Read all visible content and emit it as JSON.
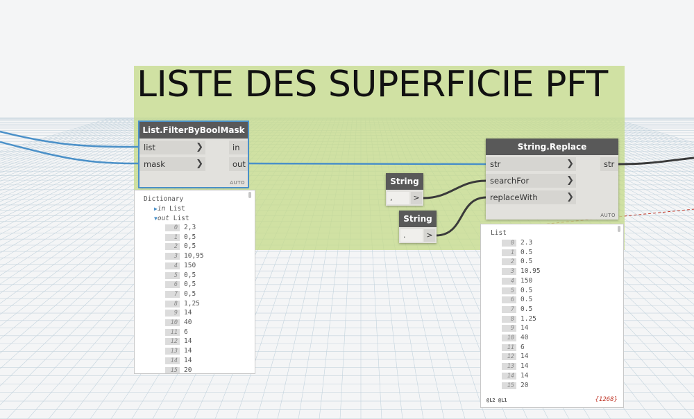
{
  "group": {
    "title": "LISTE DES SUPERFICIE PFT"
  },
  "nodes": {
    "filter": {
      "title": "List.FilterByBoolMask",
      "inputs": [
        "list",
        "mask"
      ],
      "outputs": [
        "in",
        "out"
      ],
      "badge": "AUTO"
    },
    "replace": {
      "title": "String.Replace",
      "inputs": [
        "str",
        "searchFor",
        "replaceWith"
      ],
      "outputs": [
        "str"
      ],
      "badge": "AUTO"
    },
    "string1": {
      "title": "String",
      "value": ",",
      "out": ">"
    },
    "string2": {
      "title": "String",
      "value": ".",
      "out": ">"
    }
  },
  "preview_filter": {
    "root": "Dictionary",
    "in_key": "in",
    "in_label": "List",
    "out_key": "out",
    "out_label": "List",
    "items": [
      {
        "i": "0",
        "v": "2,3"
      },
      {
        "i": "1",
        "v": "0,5"
      },
      {
        "i": "2",
        "v": "0,5"
      },
      {
        "i": "3",
        "v": "10,95"
      },
      {
        "i": "4",
        "v": "150"
      },
      {
        "i": "5",
        "v": "0,5"
      },
      {
        "i": "6",
        "v": "0,5"
      },
      {
        "i": "7",
        "v": "0,5"
      },
      {
        "i": "8",
        "v": "1,25"
      },
      {
        "i": "9",
        "v": "14"
      },
      {
        "i": "10",
        "v": "40"
      },
      {
        "i": "11",
        "v": "6"
      },
      {
        "i": "12",
        "v": "14"
      },
      {
        "i": "13",
        "v": "14"
      },
      {
        "i": "14",
        "v": "14"
      },
      {
        "i": "15",
        "v": "20"
      }
    ]
  },
  "preview_replace": {
    "root": "List",
    "items": [
      {
        "i": "0",
        "v": "2.3"
      },
      {
        "i": "1",
        "v": "0.5"
      },
      {
        "i": "2",
        "v": "0.5"
      },
      {
        "i": "3",
        "v": "10.95"
      },
      {
        "i": "4",
        "v": "150"
      },
      {
        "i": "5",
        "v": "0.5"
      },
      {
        "i": "6",
        "v": "0.5"
      },
      {
        "i": "7",
        "v": "0.5"
      },
      {
        "i": "8",
        "v": "1.25"
      },
      {
        "i": "9",
        "v": "14"
      },
      {
        "i": "10",
        "v": "40"
      },
      {
        "i": "11",
        "v": "6"
      },
      {
        "i": "12",
        "v": "14"
      },
      {
        "i": "13",
        "v": "14"
      },
      {
        "i": "14",
        "v": "14"
      },
      {
        "i": "15",
        "v": "20"
      }
    ],
    "levels": "@L2 @L1",
    "count": "{1268}"
  },
  "colors": {
    "wire_blue": "#4a90c8",
    "wire_dark": "#3a3a3a",
    "group": "#c5db8c",
    "node_header": "#595959"
  }
}
